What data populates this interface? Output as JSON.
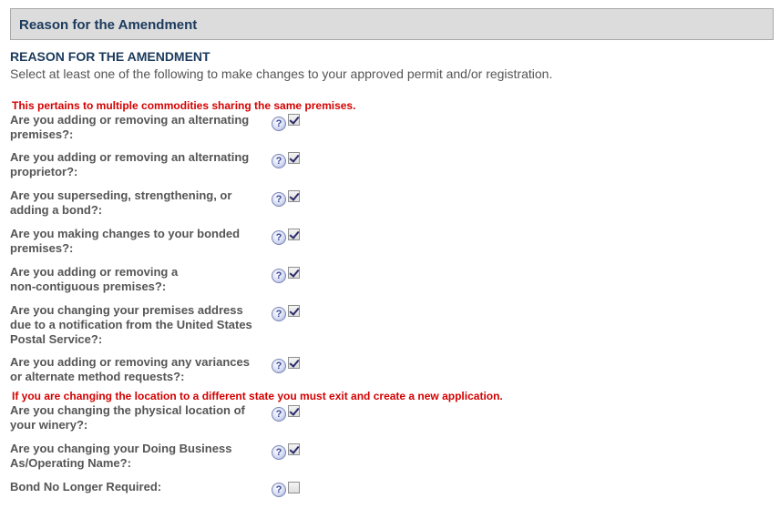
{
  "header": {
    "title": "Reason for the Amendment"
  },
  "section": {
    "title": "REASON FOR THE AMENDMENT",
    "instructions": "Select at least one of the following to make changes to your approved permit and/or registration."
  },
  "notices": {
    "multiple_commodities": "This pertains to multiple commodities sharing the same premises.",
    "state_change": "If you are changing the location to a different state you must exit and create a new application."
  },
  "help_icon_glyph": "?",
  "questions": [
    {
      "line1": "Are you adding or removing an alternating",
      "line2": "premises?:",
      "line3": "",
      "checked": true
    },
    {
      "line1": "Are you adding or removing an alternating",
      "line2": "proprietor?:",
      "line3": "",
      "checked": true
    },
    {
      "line1": "Are you superseding, strengthening, or",
      "line2": "adding a bond?:",
      "line3": "",
      "checked": true
    },
    {
      "line1": "Are you making changes to your bonded",
      "line2": "premises?:",
      "line3": "",
      "checked": true
    },
    {
      "line1": "Are you adding or removing a",
      "line2": "non-contiguous premises?:",
      "line3": "",
      "checked": true
    },
    {
      "line1": "Are you changing your premises address",
      "line2": "due to a notification from the United States",
      "line3": "Postal Service?:",
      "checked": true
    },
    {
      "line1": "Are you adding or removing any variances",
      "line2": "or alternate method requests?:",
      "line3": "",
      "checked": true
    },
    {
      "line1": "Are you changing the physical location of",
      "line2": "your winery?:",
      "line3": "",
      "checked": true
    },
    {
      "line1": "Are you changing your Doing Business",
      "line2": "As/Operating Name?:",
      "line3": "",
      "checked": true
    },
    {
      "line1": "Bond No Longer Required:",
      "line2": "",
      "line3": "",
      "checked": false
    }
  ],
  "colors": {
    "header_bg": "#dcdcdc",
    "title_blue": "#1b3a5c",
    "notice_red": "#d40000",
    "label_gray": "#555555"
  }
}
